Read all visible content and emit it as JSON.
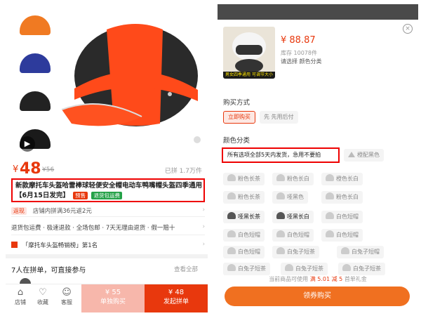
{
  "left": {
    "thumbnails": [
      "orange-helmet",
      "blue-helmet",
      "black-helmet",
      "black-helmet-video"
    ],
    "price": {
      "currency": "¥",
      "value": "48",
      "original": "¥56",
      "sold": "已拼 1.7万件"
    },
    "title": "新款摩托车头盔哈雷棒球轻便安全帽电动车鸭嘴帽头盔四季通用【6月15日发完】",
    "tags": {
      "presale": "预售",
      "refund": "退货包运费"
    },
    "promo": {
      "label": "返现",
      "text": "店铺内拼满36元返2元"
    },
    "services": "退货包运费 · 极速退款 · 全场包邮 · 7天无理由退货 · 假一赔十",
    "ranking": "「摩托车头盔畅销榜」第1名",
    "group": {
      "text": "7人在拼单，可直接参与",
      "all": "查看全部"
    },
    "bottom": {
      "store": "店铺",
      "fav": "收藏",
      "service": "客服",
      "single_price": "¥ 55",
      "single_label": "单独购买",
      "group_price": "¥ 48",
      "group_label": "发起拼单"
    }
  },
  "right": {
    "product_image_band": "男女四季通用  可调节大小",
    "price": "¥ 88.87",
    "stock": "库存 10078件",
    "choose": "请选择 颜色分类",
    "close_symbol": "×",
    "purchase_label": "购买方式",
    "purchase_options": [
      "立即购买",
      "先用后付"
    ],
    "purchase_prefix": "先",
    "color_label": "颜色分类",
    "notice": "所有选项全部5天内发货，急用不要拍",
    "colors": [
      "橙配黑色",
      "粉色长茶",
      "粉色长白",
      "橙色长白",
      "粉色长茶",
      "哑黑色",
      "粉色长白",
      "哑黑长茶",
      "哑黑长白",
      "白色短帽",
      "白色短帽",
      "白色短帽",
      "白色短帽",
      "白色短帽",
      "白兔子短茶",
      "白兔子短帽",
      "白兔子短茶",
      "白兔子短茶",
      "白兔子短茶"
    ],
    "footer_prefix": "当前商品可使用",
    "footer_highlight": "满 5.01 减 5",
    "footer_suffix": "首单礼金",
    "coupon_button": "领券购买"
  },
  "colors": {
    "accent": "#e8380d",
    "orange": "#f07020",
    "highlight_border": "#e00000"
  }
}
